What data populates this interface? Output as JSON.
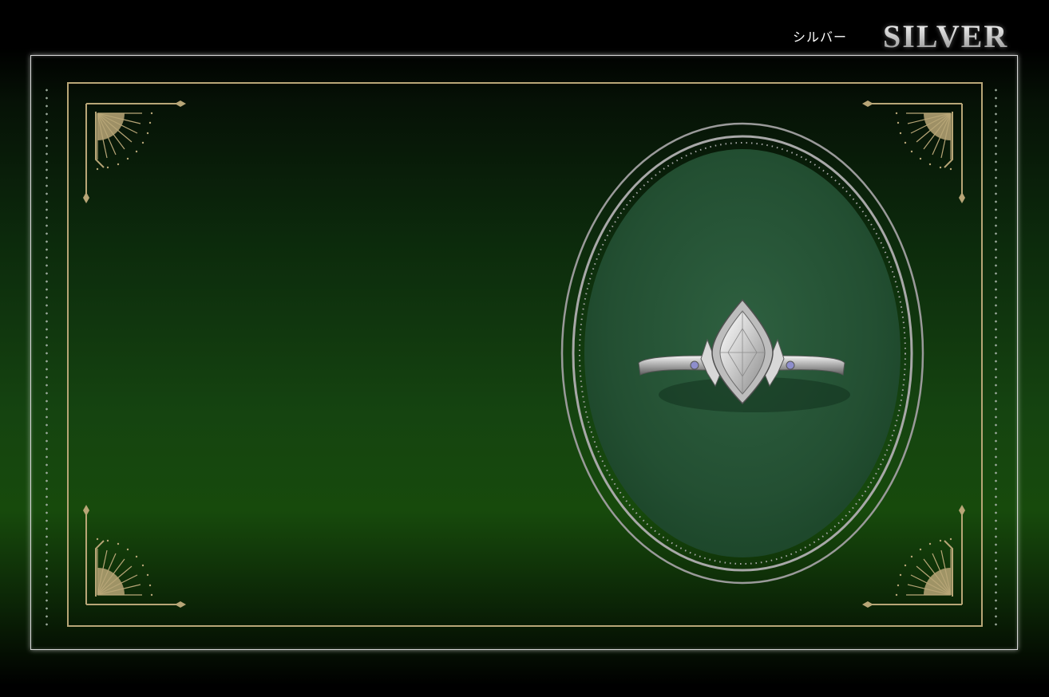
{
  "header": {
    "label_jp": "シルバー",
    "label_en": "SILVER"
  },
  "colors": {
    "background_top": "#000000",
    "background_green": "#174a0c",
    "frame_gold": "#b8a677",
    "frame_silver": "#d6d6d6",
    "medallion_felt": "#255535"
  },
  "product": {
    "type": "ring-image",
    "material": "silver"
  }
}
